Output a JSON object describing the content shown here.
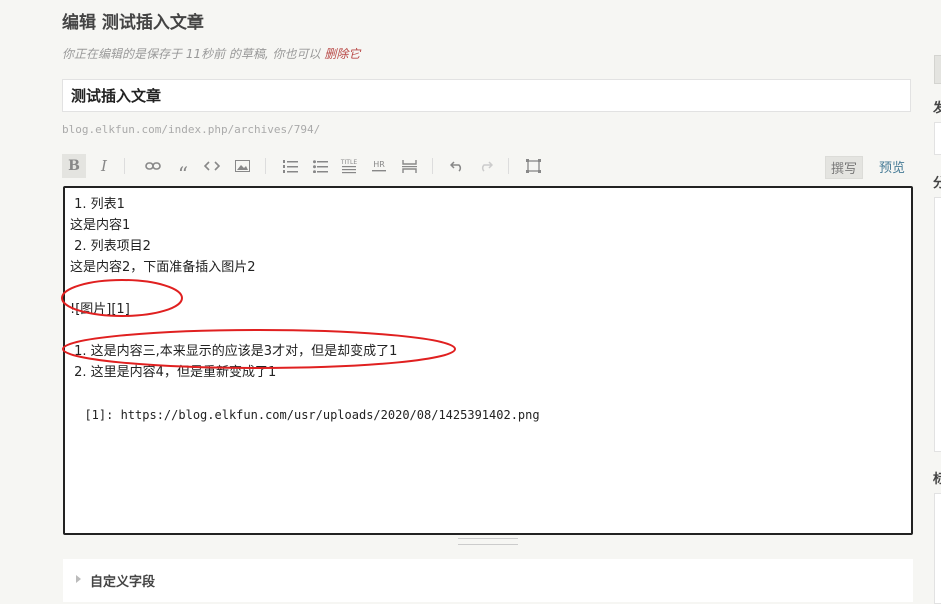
{
  "header": {
    "title": "编辑 测试插入文章",
    "draft_note": "你正在编辑的是保存于 11秒前 的草稿, 你也可以 ",
    "delete_link": "删除它"
  },
  "title_input": {
    "value": "测试插入文章"
  },
  "permalink": "blog.elkfun.com/index.php/archives/794/",
  "toolbar": {
    "bold": "B",
    "italic": "I",
    "title_label": "TITLE",
    "hr_label": "HR",
    "write_tab": "撰写",
    "preview_tab": "预览"
  },
  "editor": {
    "lines": [
      " 1. 列表1",
      "这是内容1",
      " 2. 列表项目2",
      "这是内容2，下面准备插入图片2",
      "",
      "![图片][1]",
      "",
      " 1. 这是内容三,本来显示的应该是3才对，但是却变成了1",
      " 2. 这里是内容4，但是重新变成了1",
      "",
      "  [1]: https://blog.elkfun.com/usr/uploads/2020/08/1425391402.png"
    ]
  },
  "custom_fields": {
    "label": "自定义字段"
  },
  "sidebar": {
    "labels": [
      "发",
      "分",
      "标"
    ]
  },
  "colors": {
    "link": "#467b96",
    "delete": "#b94a48",
    "annotation": "#e02020"
  }
}
